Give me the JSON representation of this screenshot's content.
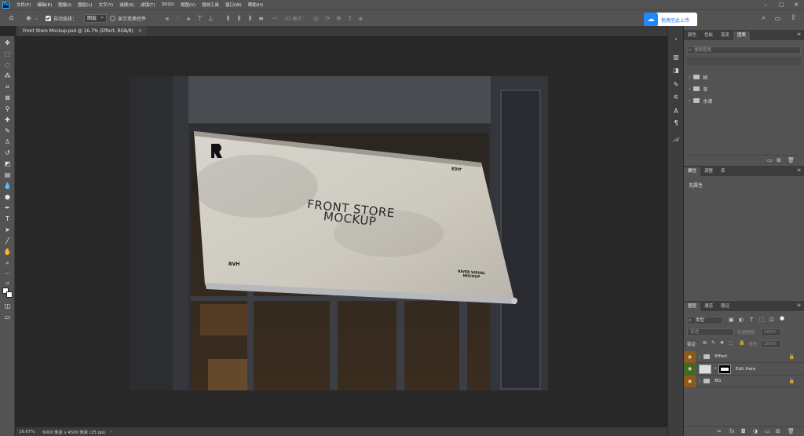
{
  "menubar": {
    "logo": "Ps",
    "items": [
      "文件(F)",
      "编辑(E)",
      "图像(I)",
      "图层(L)",
      "文字(Y)",
      "选择(S)",
      "滤镜(T)",
      "3D(D)",
      "视图(V)",
      "增效工具",
      "窗口(W)",
      "帮助(H)"
    ]
  },
  "options": {
    "auto_select_label": "自动选择：",
    "auto_select_value": "图层",
    "show_transform_label": "显示变换控件",
    "mode_3d_label": "3D 模式："
  },
  "badge": {
    "text": "拖拽至此上传"
  },
  "document": {
    "tab_title": "Front Store Mockup.psd @ 16.7% (Effect, RGB/8)",
    "close_glyph": "×"
  },
  "canvas": {
    "awning_title_line1": "FRONT STORE",
    "awning_title_line2": "MOCKUP",
    "awning_edit": "EDIT",
    "awning_rvh": "RVH",
    "awning_brand_line1": "RIVER VISUAL",
    "awning_brand_line2": "MOCKUP"
  },
  "status": {
    "zoom": "16.67%",
    "doc_size": "6000 像素 x 4500 像素 (25 ppi)",
    "arrow": "›"
  },
  "libraries_panel": {
    "tabs": [
      "颜色",
      "色板",
      "渐变",
      "图案"
    ],
    "active_tab": "图案",
    "search_placeholder": "搜索图案",
    "items": [
      "树",
      "草",
      "水滴"
    ]
  },
  "properties_panel": {
    "tabs": [
      "属性",
      "调整",
      "库"
    ],
    "active_tab": "属性",
    "empty_text": "无属性"
  },
  "layers_panel": {
    "tabs": [
      "图层",
      "通道",
      "路径"
    ],
    "active_tab": "图层",
    "filter_kind": "类型",
    "blend_mode": "穿透",
    "opacity_label": "不透明度:",
    "opacity_value": "100%",
    "lock_label": "锁定:",
    "fill_label": "填充:",
    "fill_value": "100%",
    "layers": [
      {
        "name": "Effect",
        "type": "group",
        "locked": true,
        "eye_color": "#8a5a1e"
      },
      {
        "name": "Edit Here",
        "type": "smart-object",
        "locked": false,
        "eye_color": "#3f6a25"
      },
      {
        "name": "BG",
        "type": "group",
        "locked": true,
        "eye_color": "#8a5a1e"
      }
    ]
  }
}
